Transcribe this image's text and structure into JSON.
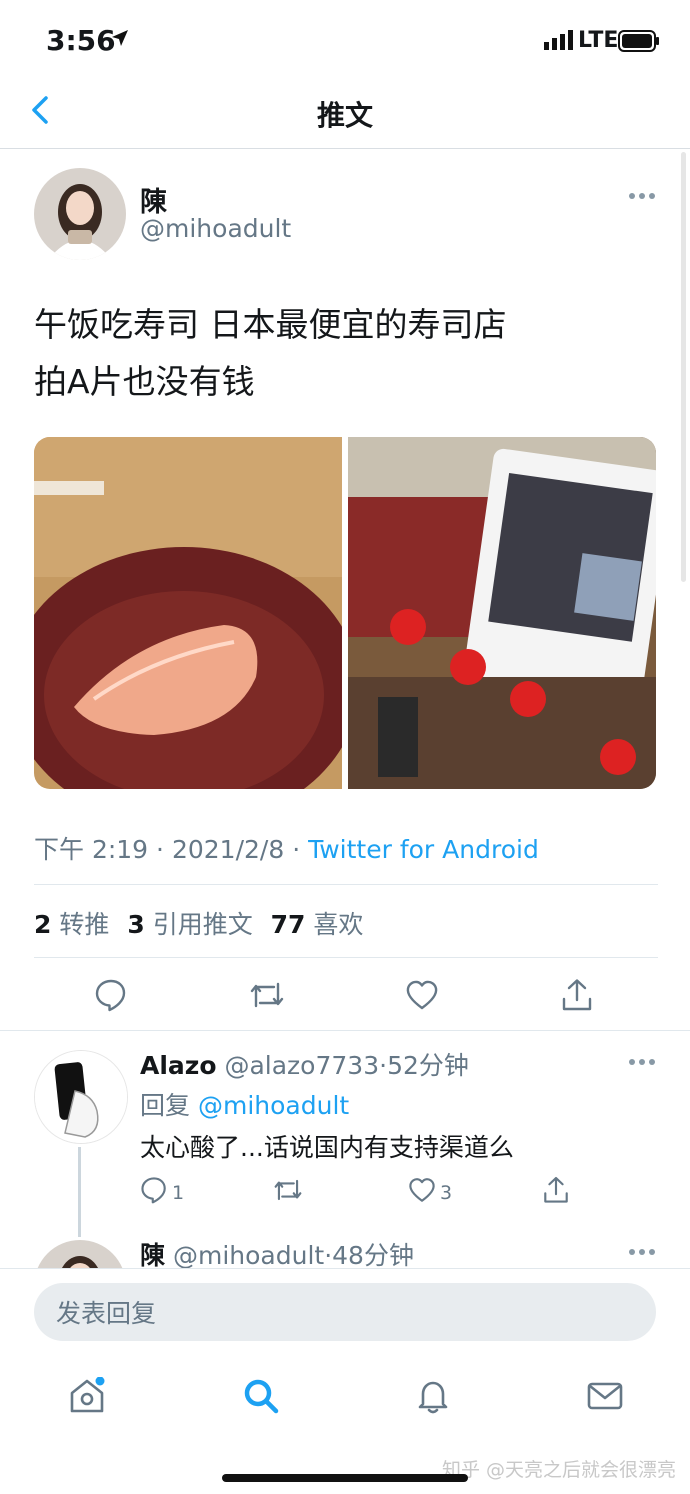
{
  "status_bar": {
    "time": "3:56",
    "network": "LTE"
  },
  "nav": {
    "title": "推文"
  },
  "tweet": {
    "author_name": "陳",
    "author_handle": "@mihoadult",
    "text_line1": "午饭吃寿司 日本最便宜的寿司店",
    "text_line2": "拍A片也没有钱",
    "time": "下午 2:19",
    "dot1": "·",
    "date": "2021/2/8",
    "dot2": "·",
    "source": "Twitter for Android",
    "retweets": "2",
    "retweets_label": "转推",
    "quotes": "3",
    "quotes_label": "引用推文",
    "likes": "77",
    "likes_label": "喜欢"
  },
  "reply1": {
    "name": "Alazo",
    "handle": "@alazo7733",
    "dot": "·",
    "time": "52分钟",
    "reply_prefix": "回复",
    "reply_to": "@mihoadult",
    "text": "太心酸了...话说国内有支持渠道么",
    "reply_count": "1",
    "like_count": "3"
  },
  "reply2": {
    "name": "陳",
    "handle": "@mihoadult",
    "dot": "·",
    "time": "48分钟"
  },
  "compose": {
    "placeholder": "发表回复"
  },
  "watermark": "知乎 @天亮之后就会很漂亮",
  "colors": {
    "accent": "#1da1f2",
    "secondary_text": "#657786",
    "divider": "#e1e8ed"
  },
  "icons": [
    "back-chevron-icon",
    "reply-icon",
    "retweet-icon",
    "like-icon",
    "share-icon",
    "home-icon",
    "search-icon",
    "notifications-icon",
    "messages-icon"
  ]
}
